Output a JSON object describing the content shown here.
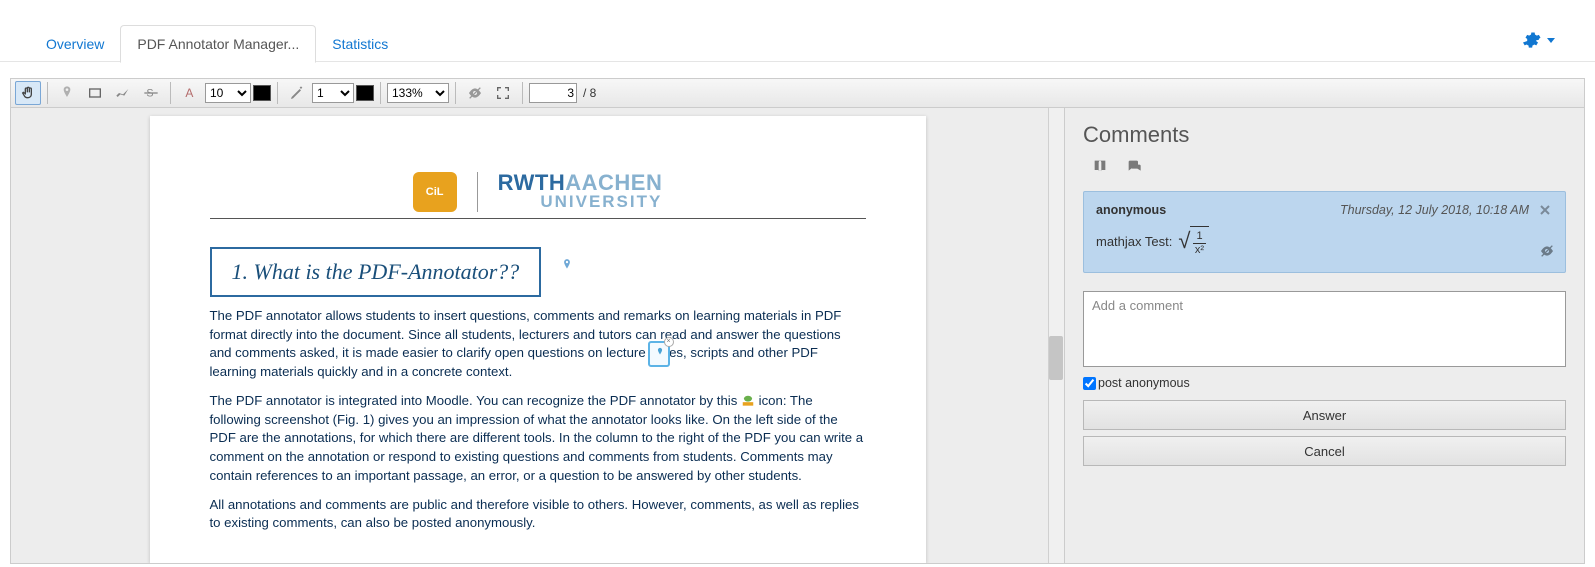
{
  "tabs": {
    "overview": "Overview",
    "manager": "PDF Annotator Manager...",
    "stats": "Statistics"
  },
  "toolbar": {
    "font_size": "10",
    "line_size": "1",
    "zoom": "133%",
    "page_current": "3",
    "page_total": "/ 8"
  },
  "doc": {
    "logo_cil": "CiL",
    "logo_rwth_bold": "RWTH",
    "logo_rwth_light": "AACHEN",
    "logo_univ": "UNIVERSITY",
    "heading": "1. What is the PDF-Annotator??",
    "p1": "The PDF annotator allows students to insert questions, comments and remarks on learning materials in PDF format directly into the document. Since all students, lecturers and tutors can read and answer the questions and comments asked, it is made easier to clarify open questions on lecture slides, scripts and other PDF learning materials quickly and in a concrete context.",
    "p2a": "The PDF annotator is integrated into Moodle. You can recognize the PDF annotator by this ",
    "p2b": " icon: The following screenshot (Fig. 1) gives you an impression of what the annotator looks like. On the left side of the PDF are the annotations, for which there are different tools. In the column to the right of the PDF you can write a comment on the annotation or respond to existing questions and comments from students. Comments may contain references to an important passage, an error, or a question to be answered by other students.",
    "p3": "All annotations and comments are public and therefore visible to others. However, comments, as well as replies to existing comments, can also be posted anonymously."
  },
  "side": {
    "title": "Comments",
    "comment": {
      "author": "anonymous",
      "time": "Thursday, 12 July 2018, 10:18 AM",
      "body_prefix": "mathjax Test:",
      "frac_num": "1",
      "frac_den": "x²"
    },
    "placeholder": "Add a comment",
    "anon_label": "post anonymous",
    "answer": "Answer",
    "cancel": "Cancel"
  }
}
